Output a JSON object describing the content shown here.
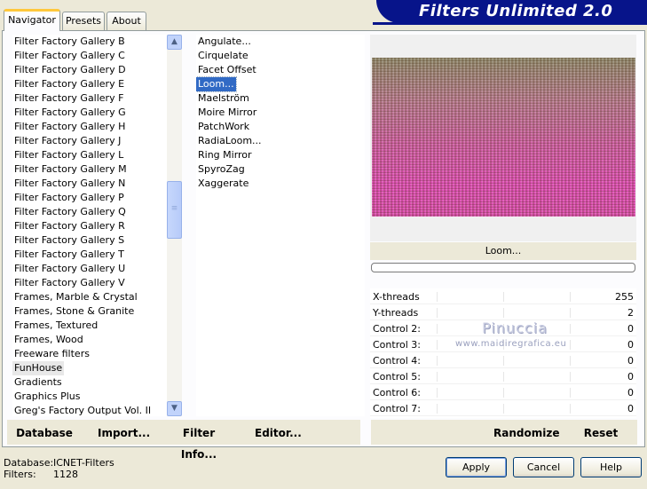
{
  "banner": {
    "title": "Filters Unlimited 2.0"
  },
  "tabs": [
    {
      "label": "Navigator",
      "active": true
    },
    {
      "label": "Presets",
      "active": false
    },
    {
      "label": "About",
      "active": false
    }
  ],
  "categories": [
    "Filter Factory Gallery B",
    "Filter Factory Gallery C",
    "Filter Factory Gallery D",
    "Filter Factory Gallery E",
    "Filter Factory Gallery F",
    "Filter Factory Gallery G",
    "Filter Factory Gallery H",
    "Filter Factory Gallery J",
    "Filter Factory Gallery L",
    "Filter Factory Gallery M",
    "Filter Factory Gallery N",
    "Filter Factory Gallery P",
    "Filter Factory Gallery Q",
    "Filter Factory Gallery R",
    "Filter Factory Gallery S",
    "Filter Factory Gallery T",
    "Filter Factory Gallery U",
    "Filter Factory Gallery V",
    "Frames, Marble & Crystal",
    "Frames, Stone & Granite",
    "Frames, Textured",
    "Frames, Wood",
    "Freeware filters",
    "FunHouse",
    "Gradients",
    "Graphics Plus",
    "Greg's Factory Output Vol. II"
  ],
  "selected_category": "FunHouse",
  "filters": [
    "Angulate...",
    "Cirquelate",
    "Facet Offset",
    "Loom...",
    "Maelström",
    "Moire Mirror",
    "PatchWork",
    "RadiaLoom...",
    "Ring Mirror",
    "SpyroZag",
    "Xaggerate"
  ],
  "selected_filter": "Loom...",
  "preview": {
    "filter_name": "Loom..."
  },
  "controls": [
    {
      "label": "X-threads",
      "value": "255"
    },
    {
      "label": "Y-threads",
      "value": "2"
    },
    {
      "label": "Control 2:",
      "value": "0"
    },
    {
      "label": "Control 3:",
      "value": "0"
    },
    {
      "label": "Control 4:",
      "value": "0"
    },
    {
      "label": "Control 5:",
      "value": "0"
    },
    {
      "label": "Control 6:",
      "value": "0"
    },
    {
      "label": "Control 7:",
      "value": "0"
    }
  ],
  "watermark": {
    "name": "Pinuccia",
    "url": "www.maidiregrafica.eu"
  },
  "toolbar": {
    "database": "Database",
    "import": "Import...",
    "filter_info": "Filter Info...",
    "editor": "Editor...",
    "randomize": "Randomize",
    "reset": "Reset"
  },
  "status": {
    "database_label": "Database:",
    "database_value": "ICNET-Filters",
    "filters_label": "Filters:",
    "filters_value": "1128"
  },
  "buttons": {
    "apply": "Apply",
    "cancel": "Cancel",
    "help": "Help"
  },
  "icons": {
    "scroll_up": "chevron-up-icon",
    "scroll_down": "chevron-down-icon",
    "scroll_grip": "grip-icon"
  }
}
